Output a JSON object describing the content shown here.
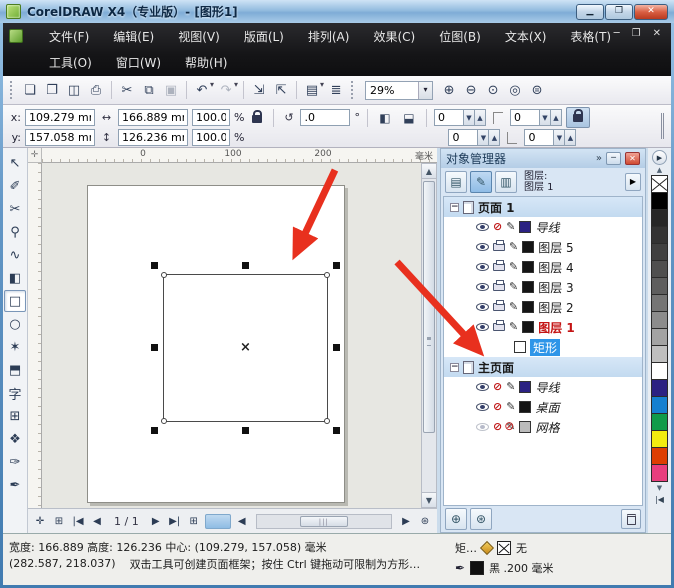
{
  "window": {
    "title": "CorelDRAW X4（专业版）- [图形1]"
  },
  "menu": {
    "row1": [
      "文件(F)",
      "编辑(E)",
      "视图(V)",
      "版面(L)",
      "排列(A)",
      "效果(C)",
      "位图(B)",
      "文本(X)",
      "表格(T)"
    ],
    "row2": [
      "工具(O)",
      "窗口(W)",
      "帮助(H)"
    ]
  },
  "toolbar": {
    "zoom_value": "29%",
    "items": [
      {
        "name": "new-document",
        "glyph": "❏"
      },
      {
        "name": "open",
        "glyph": "❐"
      },
      {
        "name": "save",
        "glyph": "◫"
      },
      {
        "name": "print",
        "glyph": "⎙"
      },
      {
        "sep": true
      },
      {
        "name": "cut",
        "glyph": "✂"
      },
      {
        "name": "copy",
        "glyph": "⧉"
      },
      {
        "name": "paste",
        "glyph": "▣",
        "disabled": true
      },
      {
        "sep": true
      },
      {
        "name": "undo",
        "glyph": "↶",
        "dropdown": true
      },
      {
        "name": "redo",
        "glyph": "↷",
        "dropdown": true,
        "disabled": true
      },
      {
        "sep": true
      },
      {
        "name": "import",
        "glyph": "⇲"
      },
      {
        "name": "export",
        "glyph": "⇱"
      },
      {
        "sep": true
      },
      {
        "name": "application-launcher",
        "glyph": "▤",
        "dropdown": true
      },
      {
        "name": "options",
        "glyph": "≣"
      }
    ],
    "zoom_items": [
      {
        "name": "zoom-in",
        "glyph": "⊕"
      },
      {
        "name": "zoom-out",
        "glyph": "⊖"
      },
      {
        "name": "zoom-selected",
        "glyph": "⊙"
      },
      {
        "name": "zoom-all",
        "glyph": "◎"
      },
      {
        "name": "zoom-page",
        "glyph": "⊜"
      }
    ]
  },
  "propbar": {
    "x_label": "x:",
    "x_value": "109.279 mm",
    "y_label": "y:",
    "y_value": "157.058 mm",
    "w_value": "166.889 mm",
    "h_value": "126.236 mm",
    "scale_w": "100.0",
    "scale_h": "100.0",
    "percent": "%",
    "rotation": ".0",
    "degree": "°",
    "corner_values": [
      "0",
      "0",
      "0",
      "0"
    ]
  },
  "ruler": {
    "labels": [
      "0",
      "100",
      "200"
    ],
    "unit": "毫米"
  },
  "toolbox": {
    "tools": [
      {
        "name": "pick-tool",
        "glyph": "↖"
      },
      {
        "name": "shape-tool",
        "glyph": "✐"
      },
      {
        "name": "crop-tool",
        "glyph": "✂"
      },
      {
        "name": "zoom-tool",
        "glyph": "⚲"
      },
      {
        "name": "freehand-tool",
        "glyph": "∿"
      },
      {
        "name": "smart-fill-tool",
        "glyph": "◧"
      },
      {
        "name": "rectangle-tool",
        "glyph": "□",
        "active": true
      },
      {
        "name": "ellipse-tool",
        "glyph": "○"
      },
      {
        "name": "polygon-tool",
        "glyph": "✶"
      },
      {
        "name": "basic-shapes-tool",
        "glyph": "⬒"
      },
      {
        "name": "text-tool",
        "glyph": "字"
      },
      {
        "name": "table-tool",
        "glyph": "⊞"
      },
      {
        "name": "blend-tool",
        "glyph": "❖"
      },
      {
        "name": "eyedropper-tool",
        "glyph": "✑"
      },
      {
        "name": "outline-tool",
        "glyph": "✒"
      }
    ]
  },
  "page_nav": {
    "page_indicator": "1 / 1"
  },
  "object_manager": {
    "title": "对象管理器",
    "layer_caption": "图层:",
    "current_layer": "图层 1",
    "rows": [
      {
        "kind": "band",
        "label": "页面 1"
      },
      {
        "kind": "layer",
        "label": "导线",
        "swatch": "#2B2182",
        "visible": true,
        "printable": false,
        "editable": true,
        "italic": true
      },
      {
        "kind": "layer",
        "label": "图层 5",
        "swatch": "#141414",
        "visible": true,
        "printable": true,
        "editable": true
      },
      {
        "kind": "layer",
        "label": "图层 4",
        "swatch": "#141414",
        "visible": true,
        "printable": true,
        "editable": true
      },
      {
        "kind": "layer",
        "label": "图层 3",
        "swatch": "#141414",
        "visible": true,
        "printable": true,
        "editable": true
      },
      {
        "kind": "layer",
        "label": "图层 2",
        "swatch": "#141414",
        "visible": true,
        "printable": true,
        "editable": true
      },
      {
        "kind": "layer",
        "label": "图层 1",
        "swatch": "#141414",
        "visible": true,
        "printable": true,
        "editable": true,
        "active": true
      },
      {
        "kind": "object",
        "label": "矩形",
        "swatch": "#FFFFFF",
        "selected": true
      },
      {
        "kind": "band",
        "label": "主页面"
      },
      {
        "kind": "layer",
        "label": "导线",
        "swatch": "#2B2182",
        "visible": true,
        "printable": false,
        "editable": true,
        "italic": true
      },
      {
        "kind": "layer",
        "label": "桌面",
        "swatch": "#141414",
        "visible": true,
        "printable": false,
        "editable": true,
        "italic": true
      },
      {
        "kind": "layer",
        "label": "网格",
        "swatch": "#BBBBBB",
        "visible": false,
        "printable": false,
        "editable": false,
        "italic": true
      }
    ]
  },
  "palette": {
    "colors": [
      "#000000",
      "#262626",
      "#333333",
      "#404040",
      "#4F4F4F",
      "#5E5E5E",
      "#757575",
      "#8C8C8C",
      "#A3A3A3",
      "#BFBFBF",
      "#FFFFFF",
      "#2B2182",
      "#1580D0",
      "#109B4A",
      "#F2EC0F",
      "#DD3E02",
      "#E83E7E"
    ]
  },
  "status_bar": {
    "line1_left": "宽度: 166.889 高度: 126.236 中心: (109.279, 157.058) 毫米",
    "object_info": "矩…",
    "fill_value": "无",
    "line2_coords": "(282.587, 218.037)",
    "line2_hint": "双击工具可创建页面框架；按住 Ctrl 键拖动可限制为方形…",
    "outline_value": "黑 .200 毫米"
  },
  "accent_colors": {
    "selection": "#2E95E8",
    "active_layer_text": "#C41414",
    "arrow": "#E8301E"
  }
}
